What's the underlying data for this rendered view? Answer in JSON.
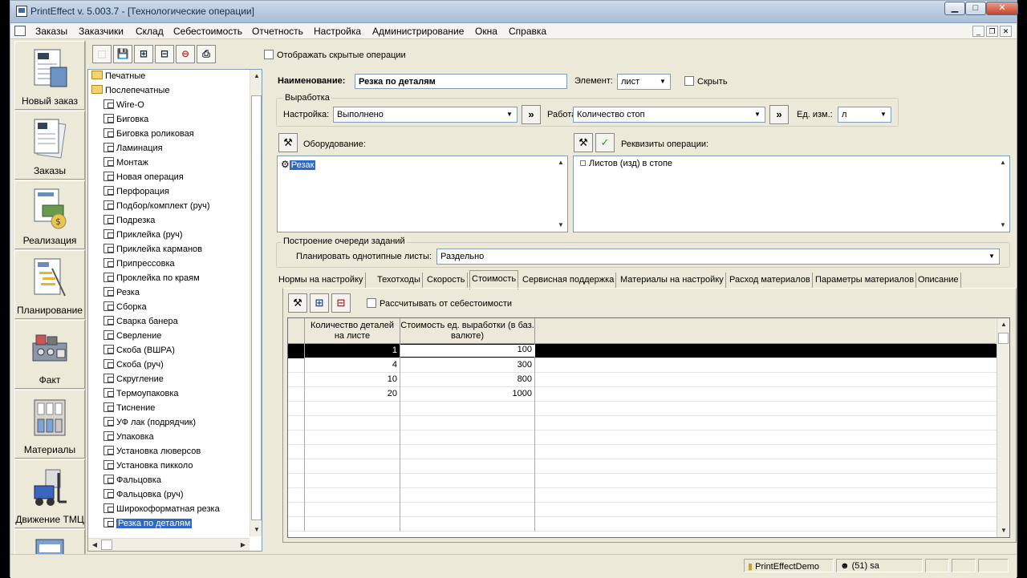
{
  "window": {
    "title": "PrintEffect v. 5.003.7 - [Технологические операции]"
  },
  "menu": [
    "Заказы",
    "Заказчики",
    "Склад",
    "Себестоимость",
    "Отчетность",
    "Настройка",
    "Администрирование",
    "Окна",
    "Справка"
  ],
  "nav": [
    {
      "label": "Новый заказ",
      "icon": "new-order-icon"
    },
    {
      "label": "Заказы",
      "icon": "orders-icon"
    },
    {
      "label": "Реализация",
      "icon": "invoice-icon"
    },
    {
      "label": "Планирование",
      "icon": "plan-icon"
    },
    {
      "label": "Факт",
      "icon": "printer-machine-icon"
    },
    {
      "label": "Материалы",
      "icon": "materials-icon"
    },
    {
      "label": "Движение ТМЦ",
      "icon": "forklift-icon"
    }
  ],
  "toolbar": {
    "show_hidden_label": "Отображать скрытые операции"
  },
  "tree": {
    "folders": [
      "Печатные",
      "Послепечатные"
    ],
    "items": [
      "Wire-O",
      "Биговка",
      "Биговка роликовая",
      "Ламинация",
      "Монтаж",
      "Новая операция",
      "Перфорация",
      "Подбор/комплект (руч)",
      "Подрезка",
      "Приклейка (руч)",
      "Приклейка карманов",
      "Припрессовка",
      "Проклейка по краям",
      "Резка",
      "Сборка",
      "Сварка банера",
      "Сверление",
      "Скоба (ВШРА)",
      "Скоба (руч)",
      "Скругление",
      "Термоупаковка",
      "Тиснение",
      "УФ лак (подрядчик)",
      "Упаковка",
      "Установка люверсов",
      "Установка пикколо",
      "Фальцовка",
      "Фальцовка (руч)",
      "Широкоформатная резка",
      "Резка по деталям"
    ],
    "selected_index": 29
  },
  "form": {
    "name_label": "Наименование:",
    "name_value": "Резка по деталям",
    "element_label": "Элемент:",
    "element_value": "лист",
    "hide_label": "Скрыть",
    "output_group": "Выработка",
    "setup_label": "Настройка:",
    "setup_value": "Выполнено",
    "work_label": "Работа:",
    "work_value": "Количество стоп",
    "unit_label": "Ед. изм.:",
    "unit_value": "л",
    "more_glyph": "»",
    "equipment_label": "Оборудование:",
    "equipment_items": [
      "Резак"
    ],
    "requisites_label": "Реквизиты операции:",
    "requisites_items": [
      "Листов (изд) в стопе"
    ],
    "queue_group": "Построение очереди заданий",
    "plan_label": "Планировать однотипные листы:",
    "plan_value": "Раздельно"
  },
  "tabs": [
    "Нормы на настройку",
    "Техотходы",
    "Скорость",
    "Стоимость",
    "Сервисная поддержка",
    "Материалы на настройку",
    "Расход материалов",
    "Параметры материалов",
    "Описание"
  ],
  "active_tab": 3,
  "cost": {
    "calc_from_cost_label": "Рассчитывать от себестоимости",
    "columns": [
      "Количество деталей на листе",
      "Стоимость ед. выработки (в баз. валюте)"
    ],
    "rows": [
      [
        "1",
        "100"
      ],
      [
        "4",
        "300"
      ],
      [
        "10",
        "800"
      ],
      [
        "20",
        "1000"
      ]
    ]
  },
  "status": {
    "db": "PrintEffectDemo",
    "user": "(51) sa"
  }
}
